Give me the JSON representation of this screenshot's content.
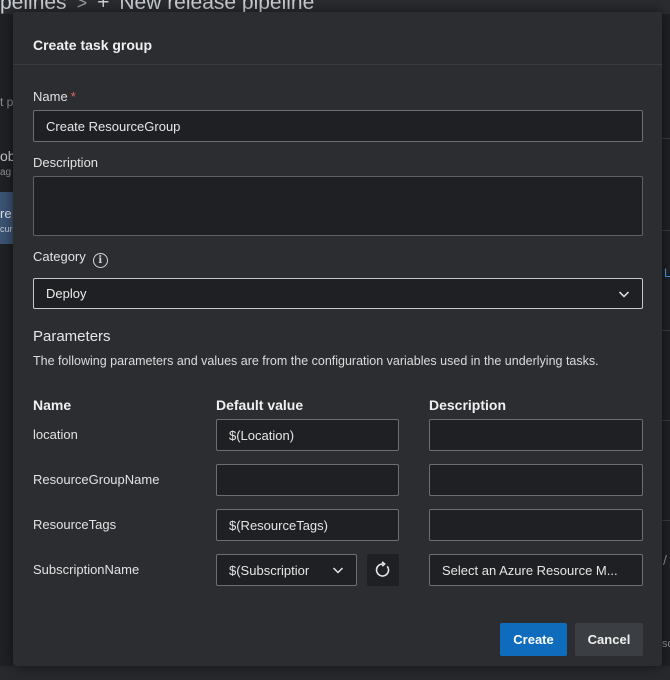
{
  "background": {
    "breadcrumb_start": "pelines",
    "breadcrumb_sep": ">",
    "breadcrumb_plus": "+",
    "breadcrumb_title": "New release pipeline",
    "fragments": [
      "t p",
      "ob",
      "ag",
      "re",
      "cur",
      "L",
      "/",
      "sc"
    ]
  },
  "dialog": {
    "title": "Create task group",
    "name_label": "Name",
    "required_mark": "*",
    "name_value": "Create ResourceGroup",
    "description_label": "Description",
    "description_value": "",
    "category_label": "Category",
    "category_value": "Deploy",
    "parameters_heading": "Parameters",
    "parameters_description": "The following parameters and values are from the configuration variables used in the underlying tasks.",
    "columns": [
      "Name",
      "Default value",
      "Description"
    ],
    "rows": [
      {
        "name": "location",
        "default": "$(Location)",
        "description": ""
      },
      {
        "name": "ResourceGroupName",
        "default": "",
        "description": ""
      },
      {
        "name": "ResourceTags",
        "default": "$(ResourceTags)",
        "description": ""
      },
      {
        "name": "SubscriptionName",
        "default": "$(Subscriptior",
        "description": "Select an Azure Resource M..."
      }
    ],
    "create_label": "Create",
    "cancel_label": "Cancel"
  },
  "colors": {
    "primary_button": "#0f6cbd",
    "required": "#e8635a",
    "dialog_bg": "#2b2d31"
  },
  "icons": [
    "info-icon",
    "chevron-down-icon",
    "refresh-icon"
  ]
}
